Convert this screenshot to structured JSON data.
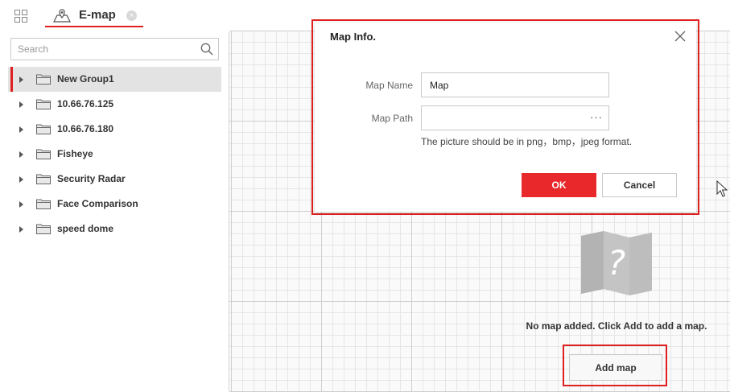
{
  "tab": {
    "label": "E-map",
    "close_glyph": "×"
  },
  "search": {
    "placeholder": "Search",
    "value": ""
  },
  "tree": [
    {
      "label": "New Group1",
      "selected": true
    },
    {
      "label": "10.66.76.125"
    },
    {
      "label": "10.66.76.180"
    },
    {
      "label": "Fisheye"
    },
    {
      "label": "Security Radar"
    },
    {
      "label": "Face Comparison"
    },
    {
      "label": "speed dome"
    }
  ],
  "dialog": {
    "title": "Map Info.",
    "name_label": "Map Name",
    "name_value": "Map",
    "path_label": "Map Path",
    "path_value": "",
    "browse_glyph": "···",
    "hint": "The picture should be in png，bmp，jpeg format.",
    "ok_label": "OK",
    "cancel_label": "Cancel"
  },
  "map": {
    "empty_message": "No map added. Click Add to add a map.",
    "add_button_label": "Add map",
    "empty_icon_glyph": "?"
  },
  "colors": {
    "accent": "#e8282b",
    "highlight_frame": "#e02020",
    "selected_row": "#e3e3e3"
  },
  "icons": [
    "apps-grid-icon",
    "map-pin-icon",
    "close-icon",
    "search-icon",
    "folder-icon",
    "map-question-icon",
    "mouse-cursor-icon"
  ]
}
